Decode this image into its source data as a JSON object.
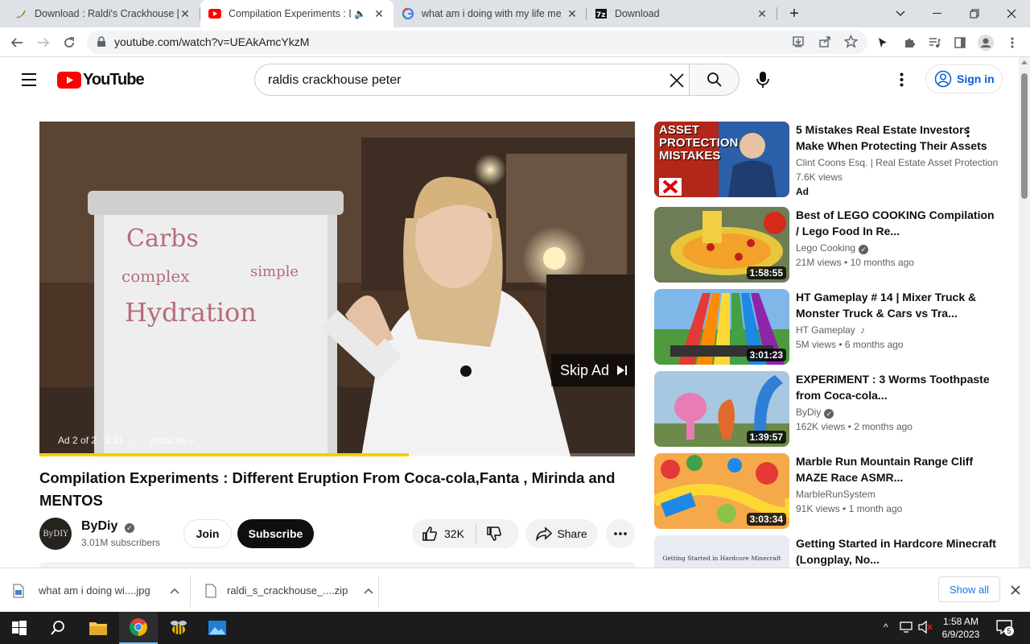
{
  "browser": {
    "tabs": [
      {
        "title": "Download : Raldi's Crackhouse [B",
        "icon": "banana-favicon-icon"
      },
      {
        "title": "Compilation Experiments : Di",
        "icon": "youtube-favicon-icon"
      },
      {
        "title": "what am i doing with my life me",
        "icon": "google-favicon-icon"
      },
      {
        "title": "Download",
        "icon": "7zip-favicon-icon"
      }
    ],
    "url": "youtube.com/watch?v=UEAkAmcYkzM"
  },
  "youtube": {
    "logo_text": "YouTube",
    "search_value": "raldis crackhouse peter",
    "sign_in": "Sign in"
  },
  "player": {
    "whiteboard": {
      "line1": "Carbs",
      "line2a": "complex",
      "line2b": "simple",
      "line3": "Hydration"
    },
    "skip_ad": "Skip Ad",
    "ad_info": "Ad 2 of 2 · 2:11",
    "ad_domain": "youtu.be",
    "progress_fraction": 0.62
  },
  "video": {
    "title": "Compilation Experiments : Different Eruption From Coca-cola,Fanta , Mirinda and MENTOS",
    "channel": "ByDiy",
    "avatar_text": "ByDIY",
    "subscribers": "3.01M subscribers",
    "join": "Join",
    "subscribe": "Subscribe",
    "likes": "32K",
    "share": "Share"
  },
  "recommendations": [
    {
      "title": "5 Mistakes Real Estate Investors Make When Protecting Their Assets",
      "channel": "Clint Coons Esq. | Real Estate Asset Protection",
      "views": "7.6K views",
      "age": "",
      "badge": "Ad",
      "duration": "",
      "thumb_text": "ASSET PROTECTION MISTAKES"
    },
    {
      "title": "Best of LEGO COOKING Compilation / Lego Food In Re...",
      "channel": "Lego Cooking",
      "views": "21M views",
      "age": "10 months ago",
      "duration": "1:58:55"
    },
    {
      "title": "HT Gameplay # 14 | Mixer Truck & Monster Truck & Cars vs Tra...",
      "channel": "HT Gameplay",
      "views": "5M views",
      "age": "6 months ago",
      "duration": "3:01:23"
    },
    {
      "title": "EXPERIMENT : 3 Worms Toothpaste from Coca-cola...",
      "channel": "ByDiy",
      "views": "162K views",
      "age": "2 months ago",
      "duration": "1:39:57"
    },
    {
      "title": "Marble Run Mountain Range Cliff MAZE Race ASMR...",
      "channel": "MarbleRunSystem",
      "views": "91K views",
      "age": "1 month ago",
      "duration": "3:03:34"
    },
    {
      "title": "Getting Started in Hardcore Minecraft (Longplay, No...",
      "channel": "",
      "views": "",
      "age": "",
      "duration": "",
      "thumb_text": "Getting Started in Hardcore Minecraft"
    }
  ],
  "downloads": [
    {
      "name": "what am i doing wi....jpg"
    },
    {
      "name": "raldi_s_crackhouse_....zip"
    }
  ],
  "show_all": "Show all",
  "taskbar": {
    "time": "1:58 AM",
    "date": "6/9/2023",
    "notification_count": "5"
  }
}
